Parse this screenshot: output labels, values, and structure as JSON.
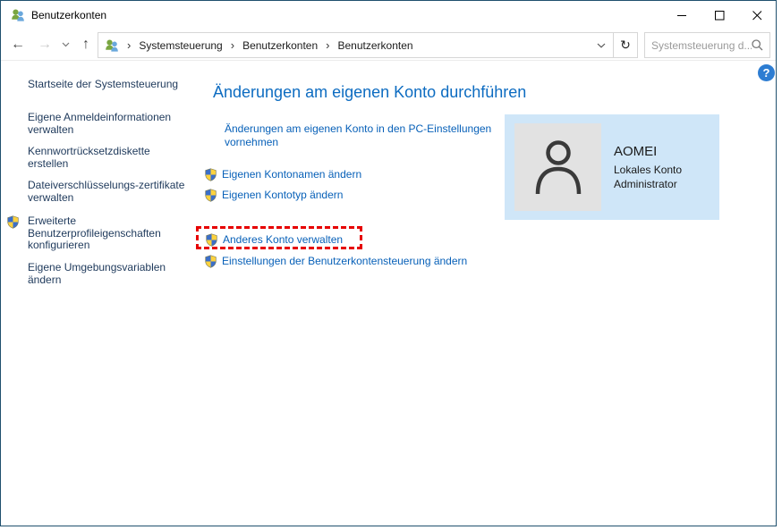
{
  "window": {
    "title": "Benutzerkonten"
  },
  "icons": {
    "app": "two-users",
    "minimize": "thin-dash",
    "maximize": "square-outline",
    "close": "x-cross",
    "back": "←",
    "forward": "→",
    "history_chevron": "chevron-down",
    "up": "↑",
    "breadcrumb_chevron": "›",
    "address_chevron": "chevron-down",
    "refresh": "↻",
    "search": "magnifier",
    "help": "?",
    "uac_shield": "blue-yellow-shield",
    "avatar": "person-outline"
  },
  "address": {
    "breadcrumb": [
      "Systemsteuerung",
      "Benutzerkonten",
      "Benutzerkonten"
    ]
  },
  "search": {
    "placeholder": "Systemsteuerung d..."
  },
  "sidebar": {
    "items": [
      {
        "label": "Startseite der Systemsteuerung"
      },
      {
        "label": "Eigene Anmeldeinformationen verwalten"
      },
      {
        "label": "Kennwortrücksetzdiskette erstellen"
      },
      {
        "label": "Dateiverschlüsselungs-zertifikate verwalten"
      },
      {
        "label": "Erweiterte Benutzerprofileigenschaften konfigurieren"
      },
      {
        "label": "Eigene Umgebungsvariablen ändern"
      }
    ]
  },
  "main": {
    "heading": "Änderungen am eigenen Konto durchführen",
    "links": [
      {
        "label": "Änderungen am eigenen Konto in den PC-Einstellungen vornehmen",
        "shield": false
      },
      {
        "label": "Eigenen Kontonamen ändern",
        "shield": true
      },
      {
        "label": "Eigenen Kontotyp ändern",
        "shield": true
      },
      {
        "label": "Anderes Konto verwalten",
        "shield": true,
        "highlighted": true
      },
      {
        "label": "Einstellungen der Benutzerkontensteuerung ändern",
        "shield": true
      }
    ],
    "account": {
      "name": "AOMEI",
      "type": "Lokales Konto",
      "role": "Administrator"
    }
  },
  "colors": {
    "window_border": "#20506e",
    "heading": "#0d6cc1",
    "link": "#0760b8",
    "sidebar_link": "#1e395b",
    "highlight_red": "#e60000",
    "panel_bg": "#cfe6f8",
    "avatar_bg": "#e2e2e2",
    "help_bg": "#2d7dd2"
  }
}
